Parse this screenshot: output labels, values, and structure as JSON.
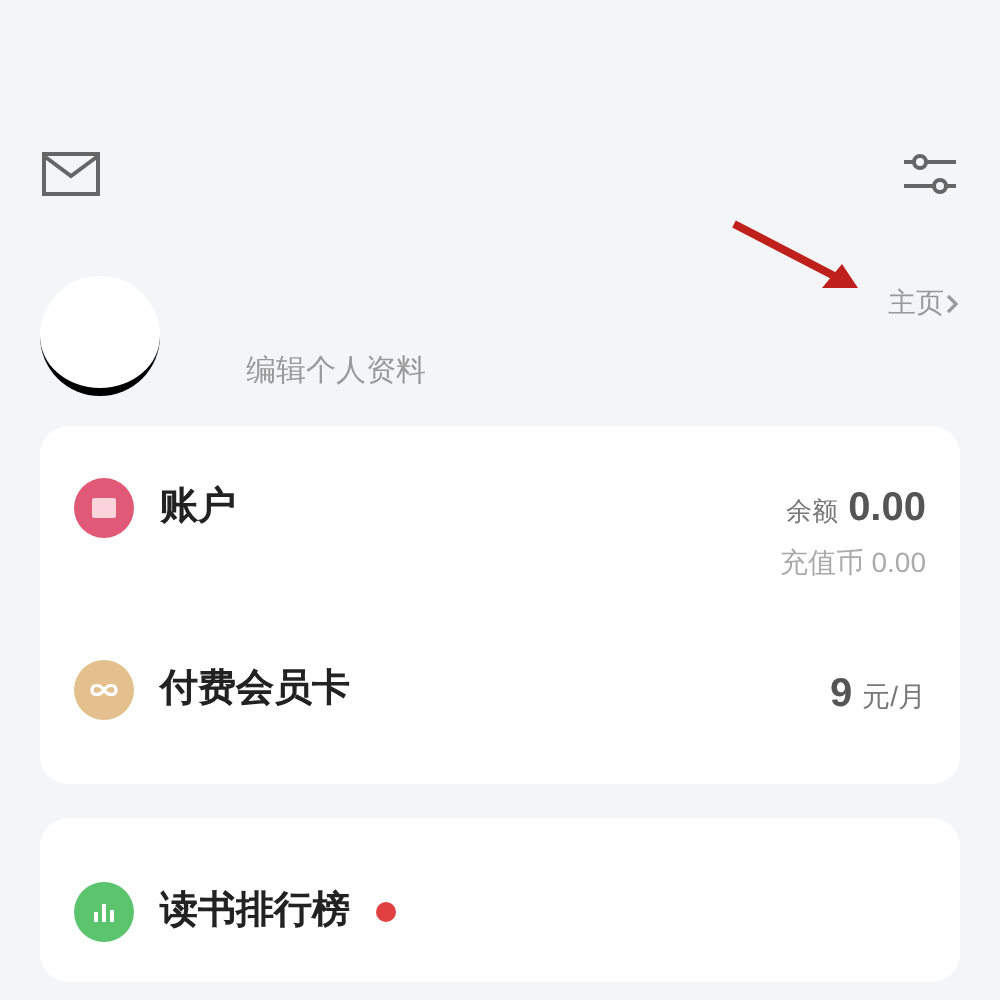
{
  "header": {
    "home_link": "主页",
    "edit_profile": "编辑个人资料"
  },
  "account_card": {
    "rows": [
      {
        "kind": "account",
        "label": "账户",
        "balance_label": "余额",
        "balance": "0.00",
        "sub": "充值币 0.00"
      },
      {
        "kind": "membership",
        "label": "付费会员卡",
        "price": "9",
        "unit": "元/月"
      }
    ]
  },
  "ranking_card": {
    "label": "读书排行榜",
    "new": true
  }
}
